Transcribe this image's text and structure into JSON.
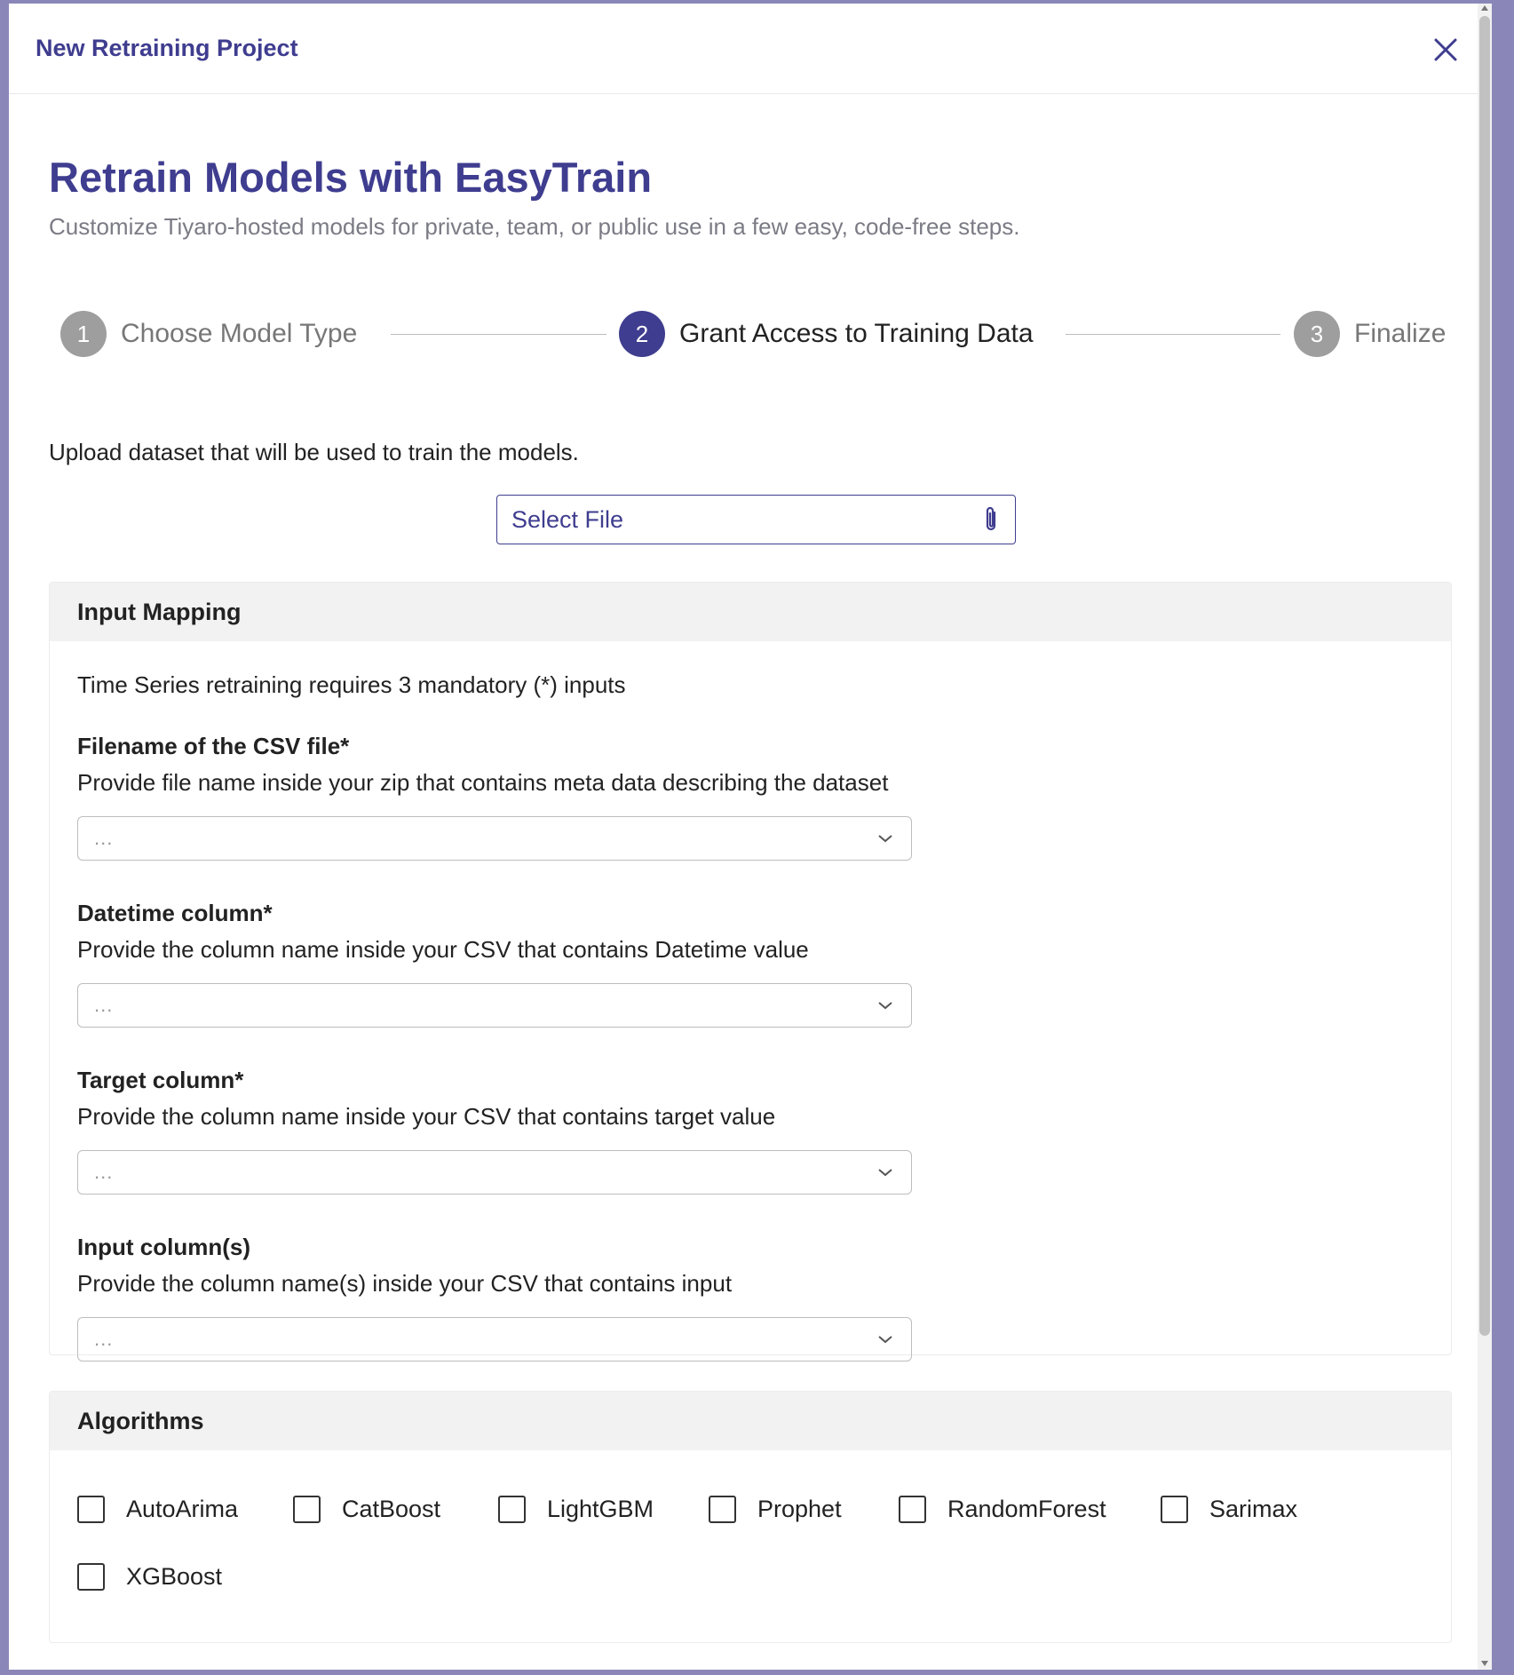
{
  "modal": {
    "title": "New Retraining Project"
  },
  "page": {
    "heading": "Retrain Models with EasyTrain",
    "subtitle": "Customize Tiyaro-hosted models for private, team, or public use in a few easy, code-free steps."
  },
  "stepper": {
    "steps": [
      {
        "number": "1",
        "label": "Choose Model Type",
        "state": "inactive"
      },
      {
        "number": "2",
        "label": "Grant Access to Training Data",
        "state": "active"
      },
      {
        "number": "3",
        "label": "Finalize",
        "state": "inactive"
      }
    ]
  },
  "upload": {
    "instruction": "Upload dataset that will be used to train the models.",
    "select_file_label": "Select File",
    "icon": "paperclip-icon"
  },
  "input_mapping": {
    "title": "Input Mapping",
    "requirement_text": "Time Series retraining requires 3 mandatory (*) inputs",
    "fields": [
      {
        "title": "Filename of the CSV file*",
        "description": "Provide file name inside your zip that contains meta data describing the dataset",
        "value": "..."
      },
      {
        "title": "Datetime column*",
        "description": "Provide the column name inside your CSV that contains Datetime value",
        "value": "..."
      },
      {
        "title": "Target column*",
        "description": "Provide the column name inside your CSV that contains target value",
        "value": "..."
      },
      {
        "title": "Input column(s)",
        "description": "Provide the column name(s) inside your CSV that contains input",
        "value": "..."
      }
    ]
  },
  "algorithms": {
    "title": "Algorithms",
    "items": [
      {
        "label": "AutoArima",
        "checked": false
      },
      {
        "label": "CatBoost",
        "checked": false
      },
      {
        "label": "LightGBM",
        "checked": false
      },
      {
        "label": "Prophet",
        "checked": false
      },
      {
        "label": "RandomForest",
        "checked": false
      },
      {
        "label": "Sarimax",
        "checked": false
      },
      {
        "label": "XGBoost",
        "checked": false
      }
    ]
  },
  "colors": {
    "primary": "#3f3d8f",
    "inactive_step": "#9e9e9e",
    "backdrop": "#8a87b8"
  }
}
